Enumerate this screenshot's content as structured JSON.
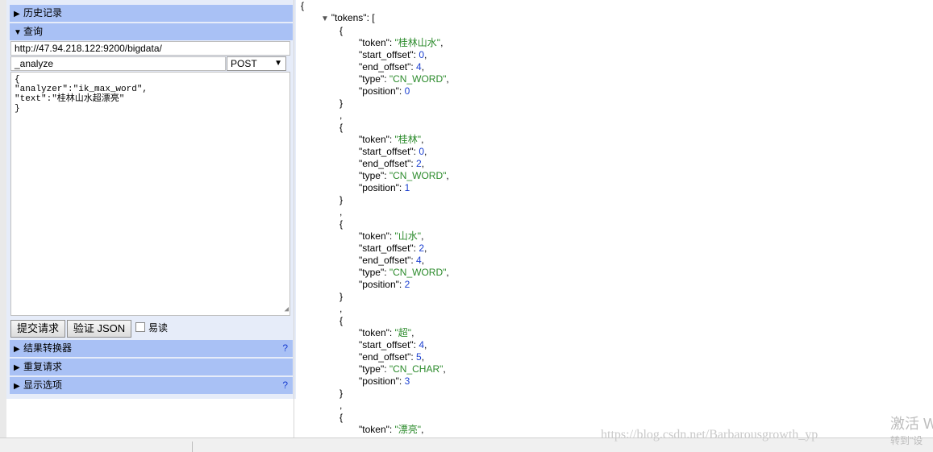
{
  "sections": {
    "history": "历史记录",
    "query": "查询",
    "converter": "结果转换器",
    "repeat": "重复请求",
    "display": "显示选项",
    "help_mark": "?"
  },
  "request": {
    "url": "http://47.94.218.122:9200/bigdata/",
    "path": "_analyze",
    "method": "POST",
    "body": "{\n\"analyzer\":\"ik_max_word\",\n\"text\":\"桂林山水超漂亮\"\n}"
  },
  "buttons": {
    "submit": "提交请求",
    "validate": "验证 JSON",
    "pretty_label": "易读"
  },
  "result": {
    "open_brace": "{",
    "tokens_key": "\"tokens\": [",
    "tokens": [
      {
        "token": "桂林山水",
        "start_offset": "0",
        "end_offset": "4",
        "type": "CN_WORD",
        "position": "0"
      },
      {
        "token": "桂林",
        "start_offset": "0",
        "end_offset": "2",
        "type": "CN_WORD",
        "position": "1"
      },
      {
        "token": "山水",
        "start_offset": "2",
        "end_offset": "4",
        "type": "CN_WORD",
        "position": "2"
      },
      {
        "token": "超",
        "start_offset": "4",
        "end_offset": "5",
        "type": "CN_CHAR",
        "position": "3"
      },
      {
        "token": "漂亮"
      }
    ]
  },
  "watermark": {
    "url": "https://blog.csdn.net/Barbarousgrowth_yp",
    "activate": "激活 W",
    "goto": "转到\"设"
  },
  "colors": {
    "section_header": "#a9c1f5",
    "panel_bg": "#e6ecf9",
    "json_string": "#2a8a2a",
    "json_number": "#1a3fd0"
  }
}
